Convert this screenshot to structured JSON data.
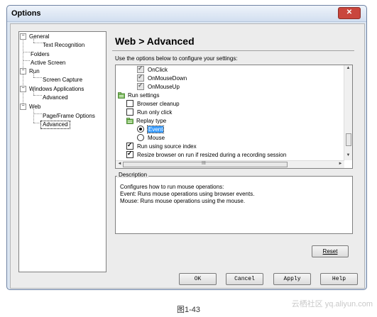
{
  "window": {
    "title": "Options",
    "close_glyph": "✕"
  },
  "tree": {
    "items": [
      {
        "label": "General",
        "expander": "−"
      },
      {
        "label": "Text Recognition"
      },
      {
        "label": "Folders"
      },
      {
        "label": "Active Screen"
      },
      {
        "label": "Run",
        "expander": "−"
      },
      {
        "label": "Screen Capture"
      },
      {
        "label": "Windows Applications",
        "expander": "−"
      },
      {
        "label": "Advanced"
      },
      {
        "label": "Web",
        "expander": "−"
      },
      {
        "label": "Page/Frame Options"
      },
      {
        "label": "Advanced",
        "selected": true
      }
    ]
  },
  "panel": {
    "heading": "Web > Advanced",
    "instructions": "Use the options below to configure your settings:"
  },
  "options": [
    {
      "label": "OnClick",
      "control": "checkbox",
      "checked": true,
      "grey": true
    },
    {
      "label": "OnMouseDown",
      "control": "checkbox",
      "checked": true,
      "grey": true
    },
    {
      "label": "OnMouseUp",
      "control": "checkbox",
      "checked": true,
      "grey": true
    },
    {
      "label": "Run settings",
      "control": "folder-icon"
    },
    {
      "label": "Browser cleanup",
      "control": "checkbox",
      "checked": false
    },
    {
      "label": "Run only click",
      "control": "checkbox",
      "checked": false
    },
    {
      "label": "Replay type",
      "control": "folder-icon"
    },
    {
      "label": "Event",
      "control": "radio",
      "selected": true
    },
    {
      "label": "Mouse",
      "control": "radio",
      "selected": false
    },
    {
      "label": "Run using source index",
      "control": "checkbox",
      "checked": true
    },
    {
      "label": "Resize browser on run if resized during a recording session",
      "control": "checkbox",
      "checked": true
    }
  ],
  "scroll": {
    "up": "▲",
    "down": "▼",
    "left": "◄",
    "right": "►",
    "grip": "III"
  },
  "description": {
    "legend": "Description",
    "lines": [
      "Configures how to run mouse operations:",
      "Event: Runs mouse operations using browser events.",
      "Mouse: Runs mouse operations using the mouse."
    ]
  },
  "buttons": {
    "reset": "Reset",
    "ok": "OK",
    "cancel": "Cancel",
    "apply": "Apply",
    "help": "Help"
  },
  "caption": "图1-43",
  "watermark": "云栖社区 yq.aliyun.com",
  "colors": {
    "selection_highlight": "#3399ff",
    "window_frame": "#dce6f2",
    "close_button": "#c9463d"
  }
}
